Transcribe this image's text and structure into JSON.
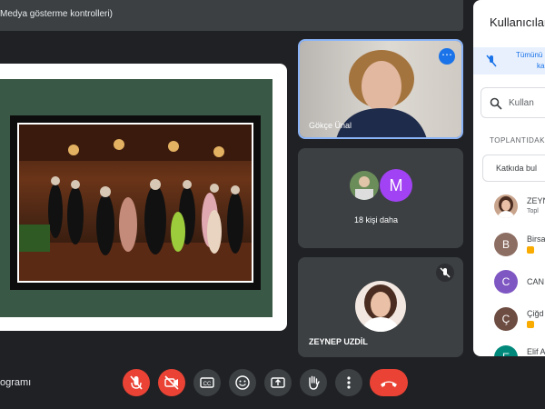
{
  "topbar": {
    "title": "Medya gösterme kontrolleri)"
  },
  "tiles": {
    "self": {
      "name": "Gökçe Ünal",
      "more_glyph": "⋯"
    },
    "more": {
      "avatar_letter": "M",
      "label": "18 kişi daha"
    },
    "zeynep": {
      "name": "ZEYNEP UZDİL"
    }
  },
  "panel": {
    "title": "Kullanıcılar",
    "mute_all_line1": "Tümünü",
    "mute_all_line2": "ka",
    "search_placeholder": "Kullan",
    "section": "TOPLANTIDAK",
    "contrib_label": "Katkıda bul",
    "participants": [
      {
        "avatar": "",
        "name": "ZEYN",
        "sub": "Topl",
        "color": "#c9a48c"
      },
      {
        "avatar": "B",
        "name": "Birsa",
        "sub": "",
        "color": "#8d6e63"
      },
      {
        "avatar": "C",
        "name": "CAN",
        "sub": "",
        "color": "#7e57c2"
      },
      {
        "avatar": "Ç",
        "name": "Çiğd",
        "sub": "",
        "color": "#6d4c41"
      },
      {
        "avatar": "E",
        "name": "Elif A",
        "sub": "",
        "color": "#00897b"
      }
    ]
  },
  "bottom": {
    "meeting_title": "ogramı"
  },
  "icons": {
    "mic": "mic-off-icon",
    "cam": "videocam-off-icon",
    "cc": "captions-icon",
    "emoji": "emoji-icon",
    "present": "present-icon",
    "hand": "raise-hand-icon",
    "more": "more-vert-icon",
    "end": "call-end-icon",
    "search": "search-icon",
    "mute_all": "mute-all-icon"
  },
  "colors": {
    "accent": "#1a73e8",
    "danger": "#ea4335",
    "background": "#202124",
    "tile": "#3c4043"
  }
}
